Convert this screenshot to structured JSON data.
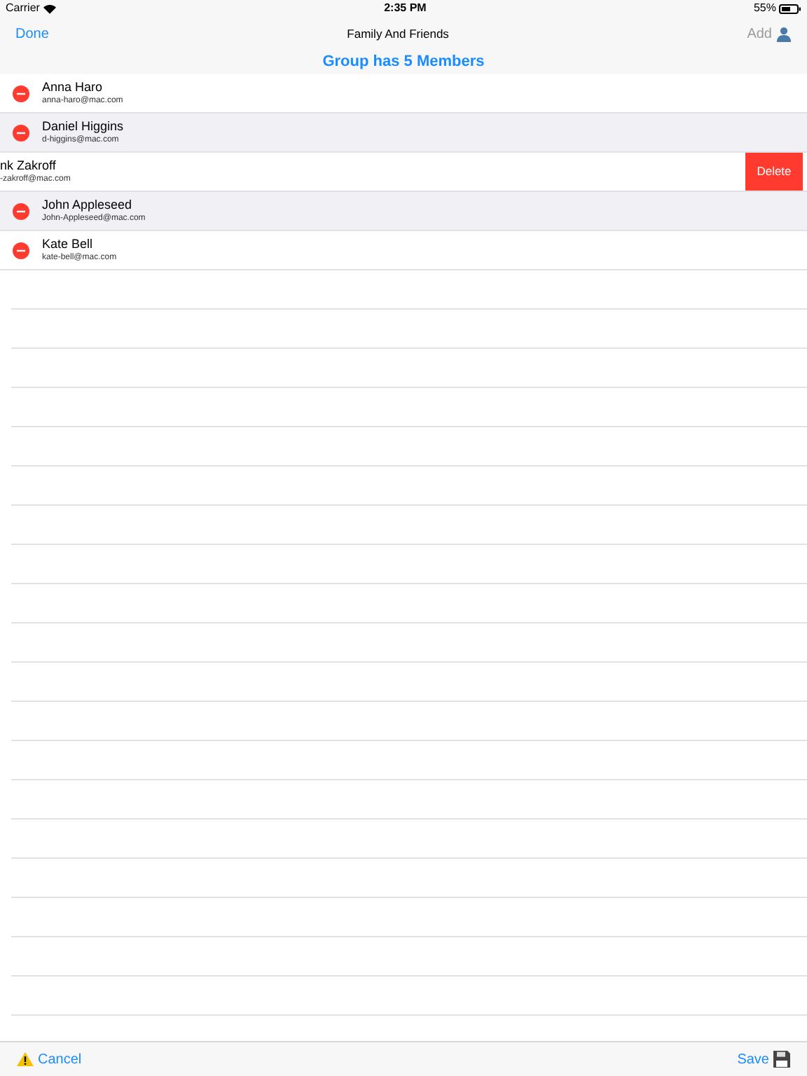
{
  "status_bar": {
    "carrier": "Carrier",
    "time": "2:35 PM",
    "battery": "55%"
  },
  "nav": {
    "left": "Done",
    "title": "Family And Friends",
    "right": "Add",
    "right_disabled": true
  },
  "header": "Group has 5 Members",
  "rows": [
    {
      "kind": "editable",
      "name": "Anna Haro",
      "email": "anna-haro@mac.com",
      "shaded": false
    },
    {
      "kind": "editable",
      "name": "Daniel Higgins",
      "email": "d-higgins@mac.com",
      "shaded": true
    },
    {
      "kind": "swiped",
      "name": "nk Zakroff",
      "email": "-zakroff@mac.com",
      "action": "Delete",
      "shaded": false
    },
    {
      "kind": "editable",
      "name": "John Appleseed",
      "email": "John-Appleseed@mac.com",
      "shaded": true
    },
    {
      "kind": "editable",
      "name": "Kate Bell",
      "email": "kate-bell@mac.com",
      "shaded": false
    }
  ],
  "toolbar": {
    "left": "Cancel",
    "right": "Save"
  }
}
